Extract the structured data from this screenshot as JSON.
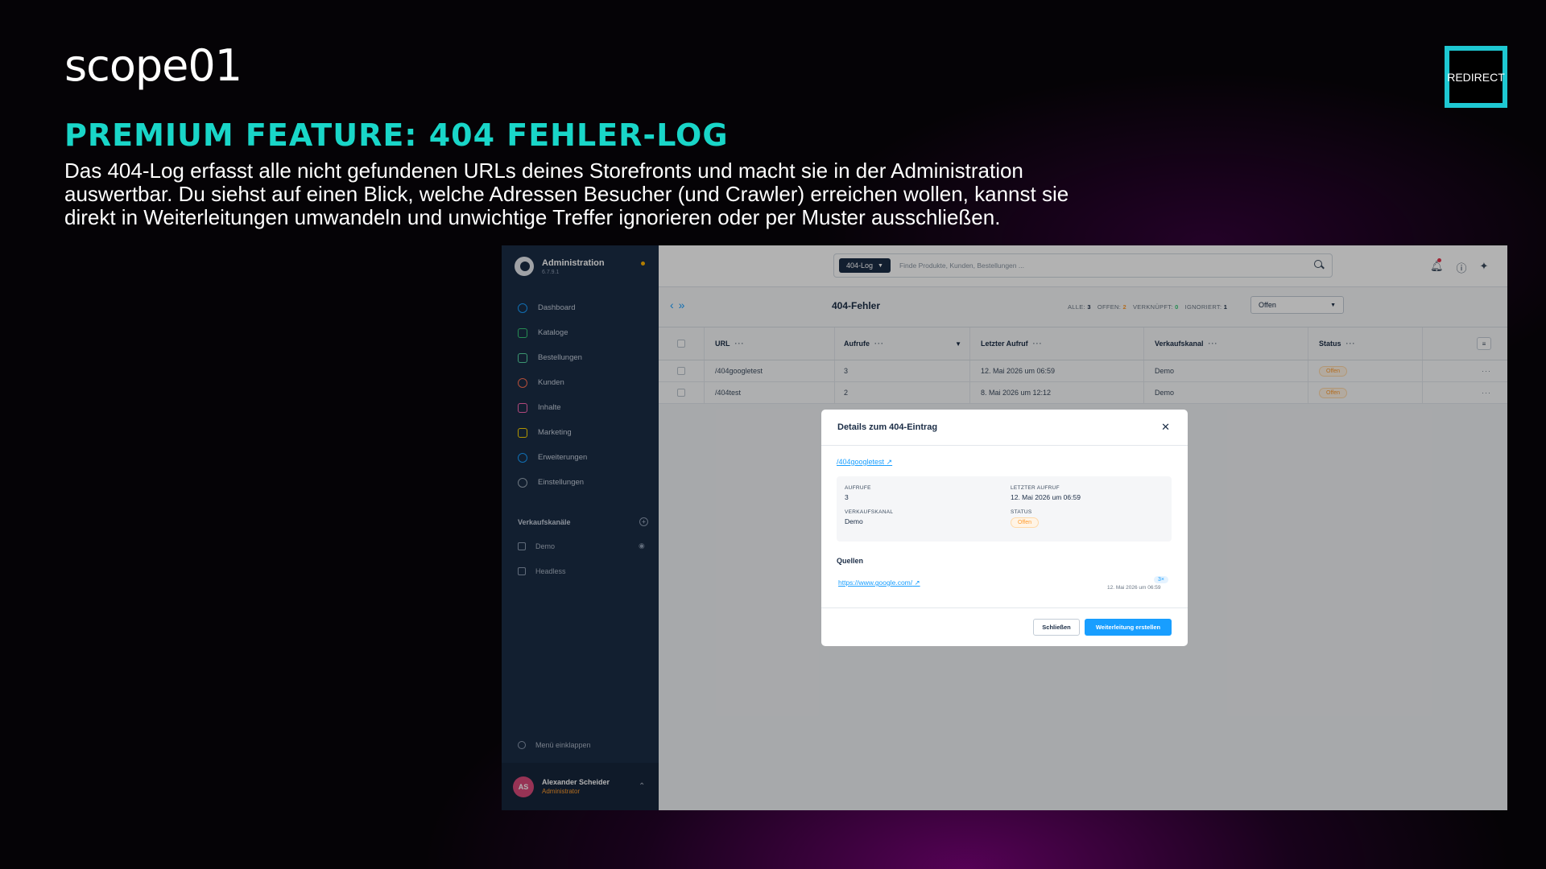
{
  "slide": {
    "logo": "scope01",
    "badge": "REDIRECT",
    "headline": "PREMIUM FEATURE: 404 FEHLER-LOG",
    "intro": "Das 404-Log erfasst alle nicht gefundenen URLs deines Storefronts und macht sie in der Administration auswertbar. Du siehst auf einen Blick, welche Adressen Besucher (und Crawler) erreichen wollen, kannst sie direkt in Weiterleitungen umwandeln und unwichtige Treffer ignorieren oder per Muster ausschließen.",
    "colors": {
      "accent": "#19d6c8",
      "badge_border": "#1ec8d2",
      "glow": "#960096"
    }
  },
  "sidebar": {
    "title": "Administration",
    "version": "6.7.9.1",
    "items": [
      {
        "label": "Dashboard",
        "icon": "dashboard-icon",
        "color": "#189eff"
      },
      {
        "label": "Kataloge",
        "icon": "catalog-icon",
        "color": "#37c977"
      },
      {
        "label": "Bestellungen",
        "icon": "bag-icon",
        "color": "#57d9a3"
      },
      {
        "label": "Kunden",
        "icon": "users-icon",
        "color": "#ff6f52"
      },
      {
        "label": "Inhalte",
        "icon": "content-icon",
        "color": "#ff68b4"
      },
      {
        "label": "Marketing",
        "icon": "megaphone-icon",
        "color": "#ffd700"
      },
      {
        "label": "Erweiterungen",
        "icon": "plug-icon",
        "color": "#189eff"
      },
      {
        "label": "Einstellungen",
        "icon": "gear-icon",
        "color": "#9aa8b5"
      }
    ],
    "section_label": "Verkaufskanäle",
    "channels": [
      {
        "label": "Demo"
      },
      {
        "label": "Headless"
      }
    ],
    "collapse_label": "Menü einklappen",
    "user": {
      "initials": "AS",
      "name": "Alexander Scheider",
      "role": "Administrator"
    }
  },
  "topbar": {
    "module_chip": "404-Log",
    "search_placeholder": "Finde Produkte, Kunden, Bestellungen ..."
  },
  "page": {
    "title": "404-Fehler",
    "counts": {
      "all_label": "ALLE:",
      "all": "3",
      "open_label": "OFFEN:",
      "open": "2",
      "linked_label": "VERKNÜPFT:",
      "linked": "0",
      "ignored_label": "IGNORIERT:",
      "ignored": "1"
    },
    "filter_value": "Offen"
  },
  "table": {
    "columns": [
      "URL",
      "Aufrufe",
      "Letzter Aufruf",
      "Verkaufskanal",
      "Status"
    ],
    "rows": [
      {
        "url": "/404googletest",
        "hits": "3",
        "last": "12. Mai 2026 um 06:59",
        "channel": "Demo",
        "status": "Offen"
      },
      {
        "url": "/404test",
        "hits": "2",
        "last": "8. Mai 2026 um 12:12",
        "channel": "Demo",
        "status": "Offen"
      }
    ]
  },
  "modal": {
    "title": "Details zum 404-Eintrag",
    "url": "/404googletest",
    "fields": {
      "hits_label": "AUFRUFE",
      "hits": "3",
      "last_label": "LETZTER AUFRUF",
      "last": "12. Mai 2026 um 06:59",
      "channel_label": "VERKAUFSKANAL",
      "channel": "Demo",
      "status_label": "STATUS",
      "status": "Offen"
    },
    "sources_title": "Quellen",
    "source": {
      "url": "https://www.google.com/",
      "count": "3×",
      "date": "12. Mai 2026 um 06:59"
    },
    "close_label": "Schließen",
    "primary_label": "Weiterleitung erstellen"
  }
}
